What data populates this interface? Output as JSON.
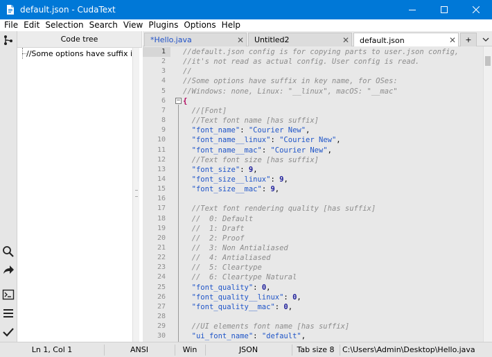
{
  "window": {
    "title": "default.json - CudaText",
    "minimize_icon": "minimize-icon",
    "maximize_icon": "maximize-icon",
    "close_icon": "close-icon"
  },
  "menu": [
    "File",
    "Edit",
    "Selection",
    "Search",
    "View",
    "Plugins",
    "Options",
    "Help"
  ],
  "sidepanel": {
    "header": "Code tree",
    "tree_items": [
      "//Some options have suffix in key name, for OSes:"
    ]
  },
  "toolbar_icons": [
    "tree-icon",
    "search-icon",
    "share-arrow-icon",
    "console-icon",
    "menu-icon",
    "checkmark-icon"
  ],
  "tabs": [
    {
      "label": "*Hello.java",
      "close": "✕"
    },
    {
      "label": "Untitled2",
      "close": "✕"
    },
    {
      "label": "default.json",
      "close": "✕"
    },
    {
      "label": "+"
    }
  ],
  "editor": {
    "lines": [
      {
        "n": "1",
        "t": "//default.json config is for copying parts to user.json config,"
      },
      {
        "n": "2",
        "t": "//it's not read as actual config. User config is read."
      },
      {
        "n": "3",
        "t": "//"
      },
      {
        "n": "4",
        "t": "//Some options have suffix in key name, for OSes:"
      },
      {
        "n": "5",
        "t": "//Windows: none, Linux: \"__linux\", macOS: \"__mac\""
      },
      {
        "n": "6",
        "t": "{"
      },
      {
        "n": "7",
        "t": "  //[Font]"
      },
      {
        "n": "8",
        "t": "  //Text font name [has suffix]"
      },
      {
        "n": "9",
        "t": "  \"font_name\": \"Courier New\","
      },
      {
        "n": "10",
        "t": "  \"font_name__linux\": \"Courier New\","
      },
      {
        "n": "11",
        "t": "  \"font_name__mac\": \"Courier New\","
      },
      {
        "n": "12",
        "t": "  //Text font size [has suffix]"
      },
      {
        "n": "13",
        "t": "  \"font_size\": 9,"
      },
      {
        "n": "14",
        "t": "  \"font_size__linux\": 9,"
      },
      {
        "n": "15",
        "t": "  \"font_size__mac\": 9,"
      },
      {
        "n": "16",
        "t": ""
      },
      {
        "n": "17",
        "t": "  //Text font rendering quality [has suffix]"
      },
      {
        "n": "18",
        "t": "  //  0: Default"
      },
      {
        "n": "19",
        "t": "  //  1: Draft"
      },
      {
        "n": "20",
        "t": "  //  2: Proof"
      },
      {
        "n": "21",
        "t": "  //  3: Non Antialiased"
      },
      {
        "n": "22",
        "t": "  //  4: Antialiased"
      },
      {
        "n": "23",
        "t": "  //  5: Cleartype"
      },
      {
        "n": "24",
        "t": "  //  6: Cleartype Natural"
      },
      {
        "n": "25",
        "t": "  \"font_quality\": 0,"
      },
      {
        "n": "26",
        "t": "  \"font_quality__linux\": 0,"
      },
      {
        "n": "27",
        "t": "  \"font_quality__mac\": 0,"
      },
      {
        "n": "28",
        "t": ""
      },
      {
        "n": "29",
        "t": "  //UI elements font name [has suffix]"
      },
      {
        "n": "30",
        "t": "  \"ui_font_name\": \"default\","
      }
    ]
  },
  "status": {
    "position": "Ln 1, Col 1",
    "encoding": "ANSI",
    "line_ending": "Win",
    "lexer": "JSON",
    "tab_size": "Tab size 8",
    "path": "C:\\Users\\Admin\\Desktop\\Hello.java"
  },
  "colors": {
    "titlebar": "#0078d7",
    "keyword": "#1f55c8",
    "comment": "#8c8c8c",
    "number": "#1d1d9a",
    "brace": "#b0005a"
  }
}
